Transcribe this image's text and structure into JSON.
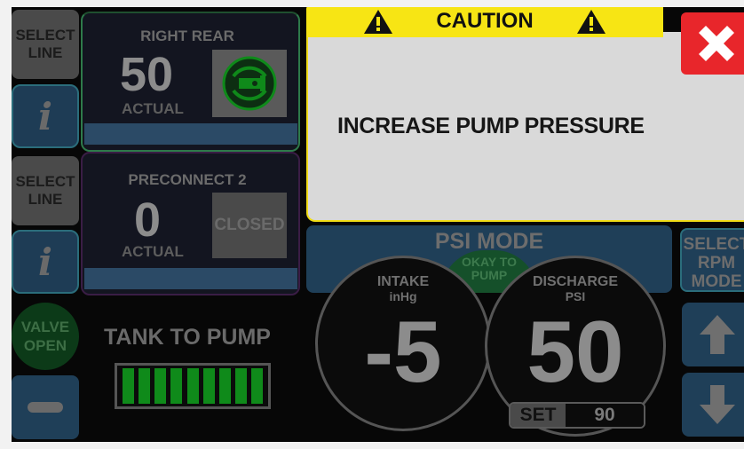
{
  "lines": [
    {
      "select_label": "SELECT\nLINE",
      "info_label": "i",
      "name": "RIGHT REAR",
      "value": "50",
      "value_label": "ACTUAL",
      "status": "nozzle-icon"
    },
    {
      "select_label": "SELECT\nLINE",
      "info_label": "i",
      "name": "PRECONNECT 2",
      "value": "0",
      "value_label": "ACTUAL",
      "status": "CLOSED"
    }
  ],
  "tank": {
    "valve_label": "VALVE\nOPEN",
    "title": "TANK TO PUMP",
    "level_segments": 9,
    "minus_icon": "minus-icon"
  },
  "caution": {
    "title": "CAUTION",
    "message": "INCREASE PUMP PRESSURE",
    "icon": "warning-icon",
    "close_icon": "close-icon"
  },
  "pump": {
    "mode_title": "PSI MODE",
    "okay_text": "OKAY TO\nPUMP",
    "intake": {
      "label": "INTAKE",
      "unit": "inHg",
      "value": "-5"
    },
    "discharge": {
      "label": "DISCHARGE",
      "unit": "PSI",
      "value": "50",
      "set_label": "SET",
      "set_value": "90"
    },
    "select_rpm_label": "SELECT\nRPM\nMODE"
  },
  "colors": {
    "caution_yellow": "#f7e514",
    "close_red": "#e8262b",
    "tank_green": "#0f8a1a",
    "panel_blue": "#1f3f58"
  }
}
